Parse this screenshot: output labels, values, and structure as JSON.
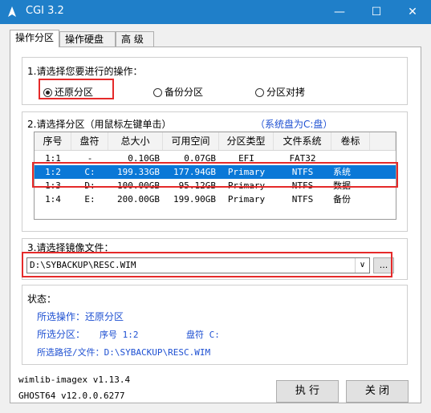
{
  "window": {
    "title": "CGI 3.2"
  },
  "tabs": [
    "操作分区",
    "操作硬盘",
    "高 级"
  ],
  "operation": {
    "label": "1.请选择您要进行的操作：",
    "options": [
      "还原分区",
      "备份分区",
      "分区对拷"
    ],
    "selected": "还原分区"
  },
  "partition": {
    "label": "2.请选择分区（用鼠标左键单击）",
    "system_note": "（系统盘为C:盘）",
    "columns": [
      "序号",
      "盘符",
      "总大小",
      "可用空间",
      "分区类型",
      "文件系统",
      "卷标"
    ],
    "rows": [
      [
        "1:1",
        "-",
        "0.10GB",
        "0.07GB",
        "EFI",
        "FAT32",
        ""
      ],
      [
        "1:2",
        "C:",
        "199.33GB",
        "177.94GB",
        "Primary",
        "NTFS",
        "系统"
      ],
      [
        "1:3",
        "D:",
        "100.00GB",
        "95.12GB",
        "Primary",
        "NTFS",
        "数据"
      ],
      [
        "1:4",
        "E:",
        "200.00GB",
        "199.90GB",
        "Primary",
        "NTFS",
        "备份"
      ]
    ],
    "selected_index": 1
  },
  "image_file": {
    "label": "3.请选择镜像文件：",
    "value": "D:\\SYBACKUP\\RESC.WIM",
    "browse_label": "..."
  },
  "status": {
    "title": "状态：",
    "operation": "所选操作：还原分区",
    "partition_prefix": "所选分区：",
    "partition_num": "序号 1:2",
    "partition_drive": "盘符 C:",
    "path": "所选路径/文件：D:\\SYBACKUP\\RESC.WIM"
  },
  "footer": {
    "line1": "wimlib-imagex v1.13.4",
    "line2": "GHOST64 v12.0.0.6277"
  },
  "buttons": {
    "execute": "执 行",
    "close": "关 闭"
  },
  "colors": {
    "titlebar": "#1f7fc9",
    "selection": "#0a78d7",
    "highlight_box": "#e52a2a",
    "status_text": "#1e50d2"
  }
}
